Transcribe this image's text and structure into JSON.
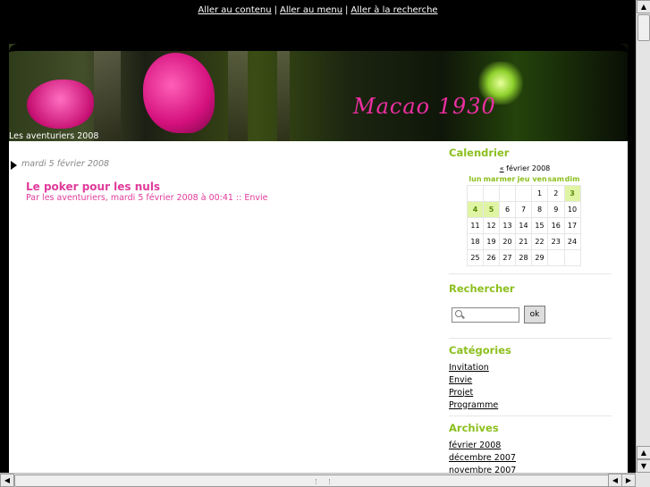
{
  "skip_links": [
    "Aller au contenu",
    "Aller au menu",
    "Aller à la recherche"
  ],
  "header": {
    "title": "Macao 1930",
    "subtitle": "Les aventuriers 2008"
  },
  "post": {
    "date": "mardi 5 février 2008",
    "title": "Le poker pour les nuls",
    "meta": "Par les aventuriers, mardi 5 février 2008 à 00:41 :: Envie"
  },
  "calendar": {
    "title": "Calendrier",
    "prev": "«",
    "month": "février 2008",
    "days": [
      "lun",
      "mar",
      "mer",
      "jeu",
      "ven",
      "sam",
      "dim"
    ],
    "weeks": [
      [
        "",
        "",
        "",
        "",
        "1",
        "2",
        "3"
      ],
      [
        "4",
        "5",
        "6",
        "7",
        "8",
        "9",
        "10"
      ],
      [
        "11",
        "12",
        "13",
        "14",
        "15",
        "16",
        "17"
      ],
      [
        "18",
        "19",
        "20",
        "21",
        "22",
        "23",
        "24"
      ],
      [
        "25",
        "26",
        "27",
        "28",
        "29",
        "",
        ""
      ]
    ],
    "post_days": [
      "3",
      "4",
      "5"
    ],
    "highlight_color": "#dff5a4"
  },
  "search": {
    "title": "Rechercher",
    "button": "ok",
    "value": ""
  },
  "categories": {
    "title": "Catégories",
    "items": [
      "Invitation",
      "Envie",
      "Projet",
      "Programme"
    ]
  },
  "archives": {
    "title": "Archives",
    "items": [
      "février 2008",
      "décembre 2007",
      "novembre 2007"
    ]
  },
  "colors": {
    "accent_green": "#8cbf1e",
    "accent_pink": "#e03b9b",
    "background": "#000000"
  }
}
